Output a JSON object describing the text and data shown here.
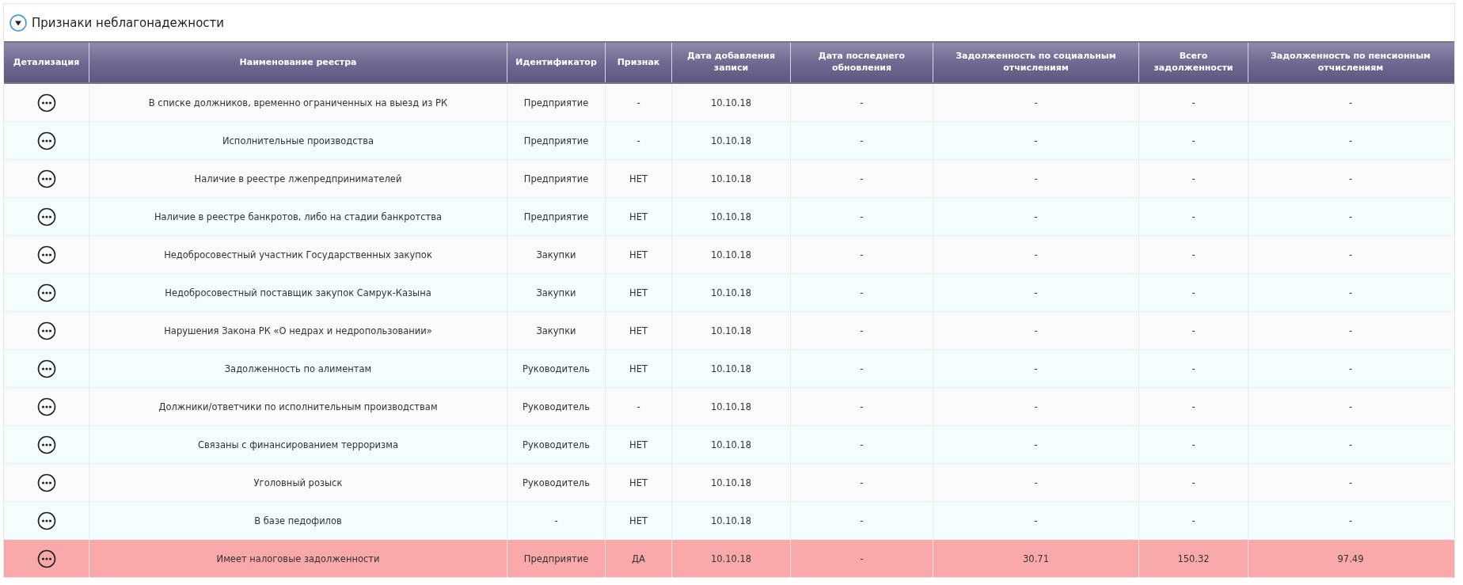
{
  "panel": {
    "title": "Признаки неблагонадежности",
    "expanded": true
  },
  "table": {
    "columns": [
      "Детализация",
      "Наименование реестра",
      "Идентификатор",
      "Признак",
      "Дата добавления записи",
      "Дата последнего обновления",
      "Задолженность по социальным отчислениям",
      "Всего задолженности",
      "Задолженность по пенсионным отчислениям"
    ],
    "rows": [
      {
        "name": "В списке должников, временно ограниченных на выезд из РК",
        "identifier": "Предприятие",
        "sign": "-",
        "added": "10.10.18",
        "updated": "-",
        "social_debt": "-",
        "total_debt": "-",
        "pension_debt": "-",
        "highlighted": false
      },
      {
        "name": "Исполнительные производства",
        "identifier": "Предприятие",
        "sign": "-",
        "added": "10.10.18",
        "updated": "-",
        "social_debt": "-",
        "total_debt": "-",
        "pension_debt": "-",
        "highlighted": false
      },
      {
        "name": "Наличие в реестре лжепредпринимателей",
        "identifier": "Предприятие",
        "sign": "НЕТ",
        "added": "10.10.18",
        "updated": "-",
        "social_debt": "-",
        "total_debt": "-",
        "pension_debt": "-",
        "highlighted": false
      },
      {
        "name": "Наличие в реестре банкротов, либо на стадии банкротства",
        "identifier": "Предприятие",
        "sign": "НЕТ",
        "added": "10.10.18",
        "updated": "-",
        "social_debt": "-",
        "total_debt": "-",
        "pension_debt": "-",
        "highlighted": false
      },
      {
        "name": "Недобросовестный участник Государственных закупок",
        "identifier": "Закупки",
        "sign": "НЕТ",
        "added": "10.10.18",
        "updated": "-",
        "social_debt": "-",
        "total_debt": "-",
        "pension_debt": "-",
        "highlighted": false
      },
      {
        "name": "Недобросовестный поставщик закупок Самрук-Казына",
        "identifier": "Закупки",
        "sign": "НЕТ",
        "added": "10.10.18",
        "updated": "-",
        "social_debt": "-",
        "total_debt": "-",
        "pension_debt": "-",
        "highlighted": false
      },
      {
        "name": "Нарушения Закона РК «О недрах и недропользовании»",
        "identifier": "Закупки",
        "sign": "НЕТ",
        "added": "10.10.18",
        "updated": "-",
        "social_debt": "-",
        "total_debt": "-",
        "pension_debt": "-",
        "highlighted": false
      },
      {
        "name": "Задолженность по алиментам",
        "identifier": "Руководитель",
        "sign": "НЕТ",
        "added": "10.10.18",
        "updated": "-",
        "social_debt": "-",
        "total_debt": "-",
        "pension_debt": "-",
        "highlighted": false
      },
      {
        "name": "Должники/ответчики по исполнительным производствам",
        "identifier": "Руководитель",
        "sign": "-",
        "added": "10.10.18",
        "updated": "-",
        "social_debt": "-",
        "total_debt": "-",
        "pension_debt": "-",
        "highlighted": false
      },
      {
        "name": "Связаны с финансированием терроризма",
        "identifier": "Руководитель",
        "sign": "НЕТ",
        "added": "10.10.18",
        "updated": "-",
        "social_debt": "-",
        "total_debt": "-",
        "pension_debt": "-",
        "highlighted": false
      },
      {
        "name": "Уголовный розыск",
        "identifier": "Руководитель",
        "sign": "НЕТ",
        "added": "10.10.18",
        "updated": "-",
        "social_debt": "-",
        "total_debt": "-",
        "pension_debt": "-",
        "highlighted": false
      },
      {
        "name": "В базе педофилов",
        "identifier": "-",
        "sign": "НЕТ",
        "added": "10.10.18",
        "updated": "-",
        "social_debt": "-",
        "total_debt": "-",
        "pension_debt": "-",
        "highlighted": false
      },
      {
        "name": "Имеет налоговые задолженности",
        "identifier": "Предприятие",
        "sign": "ДА",
        "added": "10.10.18",
        "updated": "-",
        "social_debt": "30.71",
        "total_debt": "150.32",
        "pension_debt": "97.49",
        "highlighted": true
      }
    ]
  }
}
